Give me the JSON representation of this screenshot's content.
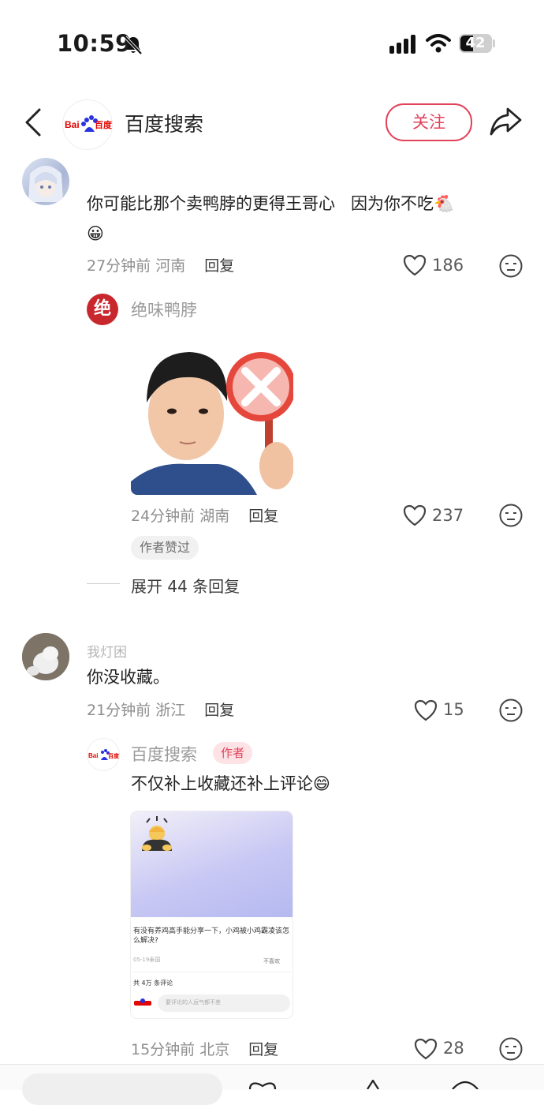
{
  "status": {
    "time": "10:59",
    "battery": "42"
  },
  "header": {
    "title": "百度搜索",
    "follow_label": "关注",
    "logo_text": "Bai度百度"
  },
  "comments": [
    {
      "user": "",
      "text_line1": "你可能比那个卖鸭脖的更得王哥心   因为你不吃🐔",
      "text_line2": "😀",
      "time": "27分钟前",
      "location": "河南",
      "reply": "回复",
      "likes": "186",
      "sub": {
        "user": "绝味鸭脖",
        "badge_char": "绝",
        "time": "24分钟前",
        "location": "湖南",
        "reply": "回复",
        "likes": "237",
        "author_liked": "作者赞过"
      },
      "expand": "展开 44 条回复"
    },
    {
      "user": "我灯困",
      "text_line1": "你没收藏。",
      "time": "21分钟前",
      "location": "浙江",
      "reply": "回复",
      "likes": "15",
      "sub": {
        "user": "百度搜索",
        "author_tag": "作者",
        "text": "不仅补上收藏还补上评论😄",
        "time": "15分钟前",
        "location": "北京",
        "reply": "回复",
        "likes": "28",
        "card": {
          "question": "有没有养鸡高手能分享一下，小鸡被小鸡霸凌该怎么解决?",
          "date": "05-19泰国",
          "dislike": "不喜欢",
          "count": "共 4万 条评论",
          "input_placeholder": "要评论的人运气都不差"
        }
      }
    }
  ],
  "colors": {
    "accent": "#e2425a",
    "brand_blue": "#2932e1",
    "brand_red": "#e10602"
  }
}
